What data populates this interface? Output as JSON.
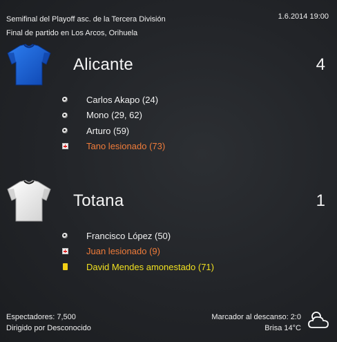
{
  "header": {
    "line1": "Semifinal del Playoff asc. de la Tercera División",
    "line2": "Final de partido en Los Arcos, Orihuela",
    "date": "1.6.2014 19:00"
  },
  "home": {
    "name": "Alicante",
    "score": "4",
    "shirt_color": "#1a5fd1",
    "events": [
      {
        "icon": "ball-icon",
        "text": "Carlos Akapo (24)",
        "kind": "goal"
      },
      {
        "icon": "ball-icon",
        "text": "Mono (29, 62)",
        "kind": "goal"
      },
      {
        "icon": "ball-icon",
        "text": "Arturo (59)",
        "kind": "goal"
      },
      {
        "icon": "injury-icon",
        "text": "Tano lesionado (73)",
        "kind": "injury"
      }
    ]
  },
  "away": {
    "name": "Totana",
    "score": "1",
    "shirt_color": "#f2f2f2",
    "events": [
      {
        "icon": "ball-icon",
        "text": "Francisco López (50)",
        "kind": "goal"
      },
      {
        "icon": "injury-icon",
        "text": "Juan lesionado (9)",
        "kind": "injury"
      },
      {
        "icon": "yellow-card-icon",
        "text": "David Mendes amonestado (71)",
        "kind": "booking"
      }
    ]
  },
  "footer": {
    "attendance": "Espectadores: 7,500",
    "referee": "Dirigido por Desconocido",
    "halftime": "Marcador al descanso: 2:0",
    "weather": "Brisa 14°C",
    "weather_icon": "cloudy-icon"
  }
}
